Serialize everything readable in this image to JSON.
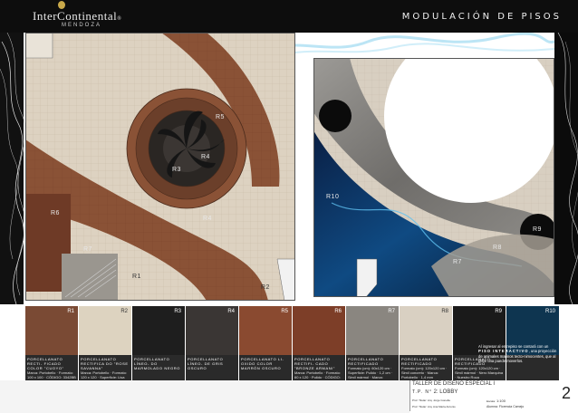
{
  "header": {
    "brand": "InterContinental",
    "brand_suffix": "®",
    "location": "MENDOZA",
    "title": "MODULACIÓN DE PISOS"
  },
  "plan_left": {
    "rooms": {
      "r1": "R1",
      "r2": "R2",
      "r3": "R3",
      "r4_center": "R4",
      "r4_band": "R4",
      "r5": "R5",
      "r6": "R6",
      "r7": "R7"
    }
  },
  "plan_right": {
    "rooms": {
      "r7": "R7",
      "r8": "R8",
      "r9": "R9",
      "r10": "R10"
    }
  },
  "swatches": [
    {
      "code": "R1",
      "color": "#7a4a34"
    },
    {
      "code": "R2",
      "color": "#ddd3c0"
    },
    {
      "code": "R3",
      "color": "#1e1e1e"
    },
    {
      "code": "R4",
      "color": "#3a3634"
    },
    {
      "code": "R5",
      "color": "#8a4a30"
    },
    {
      "code": "R6",
      "color": "#7d3e28"
    },
    {
      "code": "R7",
      "color": "#8a8680"
    },
    {
      "code": "R8",
      "color": "#d9d0c2"
    },
    {
      "code": "R9",
      "color": "#1a1a1a"
    },
    {
      "code": "R10",
      "color": "#0e3550"
    }
  ],
  "descriptions": [
    {
      "name": "PORCELLANATO RECTI- FICADO COLOR \"CUOYO\"",
      "detail": "Marca: Portobello · Formato: 100 x 100 · CÓDIGO: 3342BB"
    },
    {
      "name": "PORCELLANATO RECTIFICA DO \"ROSE SAVANNA\"",
      "detail": "Marca: Portobello · Formato: 120 x 120 · Superficie: Lisa pulida"
    },
    {
      "name": "PORCELLANATO LÍNEO- DO MARMOLADO NEGRO",
      "detail": ""
    },
    {
      "name": "PORCELLANATO LÍNEO- DE GRIS OSCURO",
      "detail": ""
    },
    {
      "name": "PORCELLANATO LI- OXIDO COLOR MARRÓN OSCURO",
      "detail": ""
    },
    {
      "name": "PORCELLANATO RECTIFI- CADO \"BRONZE ARMANI\"",
      "detail": "Marca: Portobello · Formato: 60 x 120 · Pulido · CÓDIGO: 23404B"
    },
    {
      "name": "PORCELLANATO RECTIFICADO",
      "detail": "Formato (cm): 60x120 cm · Superficie: Pulido · 1,2 cm · Simil mármol · Marca: Portobello"
    },
    {
      "name": "PORCELLANATO RECTIFICADO",
      "detail": "Formato (cm): 120x120 cm · Simil concreto · Marca: Portobello · 1,4 mm"
    },
    {
      "name": "PORCELLANATO RECTIFICADO",
      "detail": "Formato (cm): 120x120 cm · Simil mármol · Nero Marquina · Nuestro Roca"
    },
    {
      "name": "",
      "detail": ""
    }
  ],
  "note": {
    "text_before": "Al ingresar al entrepiso se contará con un",
    "highlight": "PISO INTERACTIVO",
    "text_after": ", una proyección de animales marinos tecto-nimocentes, que al pisar una puede moverlos."
  },
  "title_block": {
    "course": "TALLER DE DISEÑO ESPECIAL I",
    "tp_label": "T.P. N°",
    "tp_value": "2: LOBBY",
    "prof_1": "Prof. Titular: Arq. Jorge Gonella",
    "prof_2": "Prof. Titular: Arq. Ana María Antonio",
    "scale_label": "Escala:",
    "scale_value": "1:100",
    "student_label": "Alumna:",
    "student": "Florencia Camejo",
    "sheet": "2"
  },
  "colors": {
    "header_bg": "#0d0d0d",
    "tile_beige": "#ddd2c1",
    "wood": "#8a5236",
    "dark_marble": "#1f1f1f",
    "water_blue": "#0d3a66"
  }
}
